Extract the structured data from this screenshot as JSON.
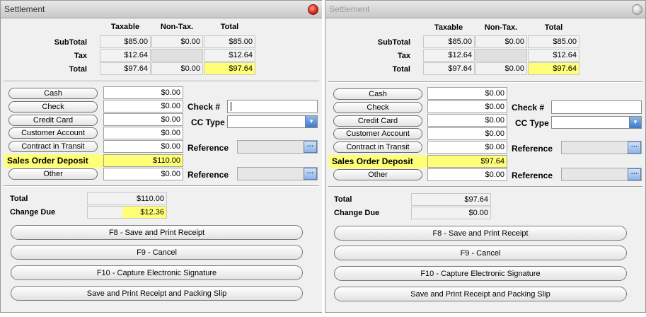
{
  "left": {
    "title": "Settlement",
    "columns": [
      "Taxable",
      "Non-Tax.",
      "Total"
    ],
    "summary": {
      "subtotal": {
        "label": "SubTotal",
        "taxable": "$85.00",
        "nontax": "$0.00",
        "total": "$85.00"
      },
      "tax": {
        "label": "Tax",
        "taxable": "$12.64",
        "total": "$12.64"
      },
      "total": {
        "label": "Total",
        "taxable": "$97.64",
        "nontax": "$0.00",
        "total": "$97.64"
      }
    },
    "payments": {
      "cash": {
        "label": "Cash",
        "value": "$0.00"
      },
      "check": {
        "label": "Check",
        "value": "$0.00"
      },
      "credit_card": {
        "label": "Credit Card",
        "value": "$0.00"
      },
      "customer_account": {
        "label": "Customer Account",
        "value": "$0.00"
      },
      "contract_in_transit": {
        "label": "Contract in Transit",
        "value": "$0.00"
      },
      "sales_order_deposit": {
        "label": "Sales Order Deposit",
        "value": "$110.00"
      },
      "other": {
        "label": "Other",
        "value": "$0.00"
      }
    },
    "fields": {
      "check_no": "Check #",
      "cc_type": "CC Type",
      "reference1": "Reference",
      "reference2": "Reference"
    },
    "totals": {
      "total_label": "Total",
      "total_value": "$110.00",
      "change_label": "Change Due",
      "change_value": "$12.36"
    },
    "buttons": {
      "save_print": "F8 - Save and Print Receipt",
      "cancel": "F9 - Cancel",
      "signature": "F10 - Capture Electronic Signature",
      "packing_slip": "Save and Print Receipt and Packing Slip"
    }
  },
  "right": {
    "title": "Settlement",
    "columns": [
      "Taxable",
      "Non-Tax.",
      "Total"
    ],
    "summary": {
      "subtotal": {
        "label": "SubTotal",
        "taxable": "$85.00",
        "nontax": "$0.00",
        "total": "$85.00"
      },
      "tax": {
        "label": "Tax",
        "taxable": "$12.64",
        "total": "$12.64"
      },
      "total": {
        "label": "Total",
        "taxable": "$97.64",
        "nontax": "$0.00",
        "total": "$97.64"
      }
    },
    "payments": {
      "cash": {
        "label": "Cash",
        "value": "$0.00"
      },
      "check": {
        "label": "Check",
        "value": "$0.00"
      },
      "credit_card": {
        "label": "Credit Card",
        "value": "$0.00"
      },
      "customer_account": {
        "label": "Customer Account",
        "value": "$0.00"
      },
      "contract_in_transit": {
        "label": "Contract in Transit",
        "value": "$0.00"
      },
      "sales_order_deposit": {
        "label": "Sales Order Deposit",
        "value": "$97.64"
      },
      "other": {
        "label": "Other",
        "value": "$0.00"
      }
    },
    "fields": {
      "check_no": "Check #",
      "cc_type": "CC Type",
      "reference1": "Reference",
      "reference2": "Reference"
    },
    "totals": {
      "total_label": "Total",
      "total_value": "$97.64",
      "change_label": "Change Due",
      "change_value": "$0.00"
    },
    "buttons": {
      "save_print": "F8 - Save and Print Receipt",
      "cancel": "F9 - Cancel",
      "signature": "F10 - Capture Electronic Signature",
      "packing_slip": "Save and Print Receipt and Packing Slip"
    }
  },
  "colors": {
    "highlight": "#ffff77",
    "window_bg": "#f0f0f0",
    "close_active": "#d8241a"
  },
  "icons": {
    "close": "close-icon",
    "dropdown": "chevron-down-icon",
    "lookup": "ellipsis-icon"
  }
}
